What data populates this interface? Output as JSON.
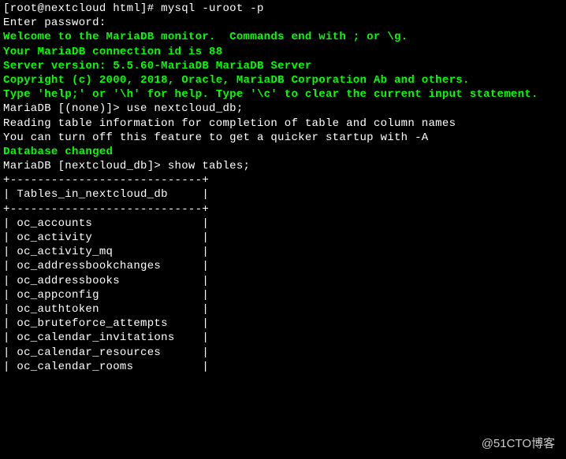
{
  "terminal": {
    "prompt_line": "[root@nextcloud html]# mysql -uroot -p",
    "enter_password": "Enter password:",
    "welcome": "Welcome to the MariaDB monitor.  Commands end with ; or \\g.",
    "connection_id": "Your MariaDB connection id is 88",
    "server_version": "Server version: 5.5.60-MariaDB MariaDB Server",
    "blank1": "",
    "copyright": "Copyright (c) 2000, 2018, Oracle, MariaDB Corporation Ab and others.",
    "blank2": "",
    "help_line": "Type 'help;' or '\\h' for help. Type '\\c' to clear the current input statement.",
    "blank3": "",
    "mariadb_none": "MariaDB [(none)]> use nextcloud_db;",
    "reading_info": "Reading table information for completion of table and column names",
    "turn_off": "You can turn off this feature to get a quicker startup with -A",
    "blank4": "",
    "db_changed": "Database changed",
    "mariadb_db": "MariaDB [nextcloud_db]> show tables;",
    "border_top": "+----------------------------+",
    "header": "| Tables_in_nextcloud_db     |",
    "border_mid": "+----------------------------+",
    "tables": [
      "| oc_accounts                |",
      "| oc_activity                |",
      "| oc_activity_mq             |",
      "| oc_addressbookchanges      |",
      "| oc_addressbooks            |",
      "| oc_appconfig               |",
      "| oc_authtoken               |",
      "| oc_bruteforce_attempts     |",
      "| oc_calendar_invitations    |",
      "| oc_calendar_resources      |",
      "| oc_calendar_rooms          |"
    ]
  },
  "watermark": "@51CTO博客"
}
